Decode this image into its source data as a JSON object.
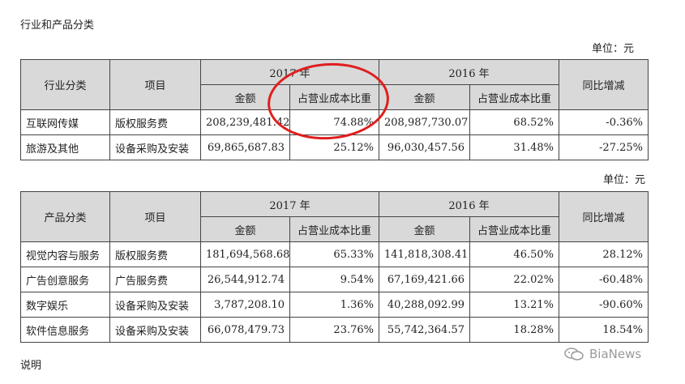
{
  "section_title": "行业和产品分类",
  "unit_label": "单位：元",
  "unit_label_2": "单位：元",
  "headers": {
    "industry": "行业分类",
    "product": "产品分类",
    "item": "项目",
    "year_2017": "2017 年",
    "year_2016": "2016 年",
    "amount": "金额",
    "ratio": "占营业成本比重",
    "yoy": "同比增减"
  },
  "industry_rows": [
    {
      "category": "互联网传媒",
      "item": "版权服务费",
      "amount_2017": "208,239,481.42",
      "ratio_2017": "74.88%",
      "amount_2016": "208,987,730.07",
      "ratio_2016": "68.52%",
      "yoy": "-0.36%"
    },
    {
      "category": "旅游及其他",
      "item": "设备采购及安装",
      "amount_2017": "69,865,687.83",
      "ratio_2017": "25.12%",
      "amount_2016": "96,030,457.56",
      "ratio_2016": "31.48%",
      "yoy": "-27.25%"
    }
  ],
  "product_rows": [
    {
      "category": "视觉内容与服务",
      "item": "版权服务费",
      "amount_2017": "181,694,568.68",
      "ratio_2017": "65.33%",
      "amount_2016": "141,818,308.41",
      "ratio_2016": "46.50%",
      "yoy": "28.12%"
    },
    {
      "category": "广告创意服务",
      "item": "广告服务费",
      "amount_2017": "26,544,912.74",
      "ratio_2017": "9.54%",
      "amount_2016": "67,169,421.66",
      "ratio_2016": "22.02%",
      "yoy": "-60.48%"
    },
    {
      "category": "数字娱乐",
      "item": "设备采购及安装",
      "amount_2017": "3,787,208.10",
      "ratio_2017": "1.36%",
      "amount_2016": "40,288,092.99",
      "ratio_2016": "13.21%",
      "yoy": "-90.60%"
    },
    {
      "category": "软件信息服务",
      "item": "设备采购及安装",
      "amount_2017": "66,078,479.73",
      "ratio_2017": "23.76%",
      "amount_2016": "55,742,364.57",
      "ratio_2016": "18.28%",
      "yoy": "18.54%"
    }
  ],
  "note_label": "说明",
  "watermark": "BiaNews",
  "colors": {
    "header_bg": "#d9d9d9",
    "annotation_circle": "#e01e1e",
    "border": "#444444"
  }
}
